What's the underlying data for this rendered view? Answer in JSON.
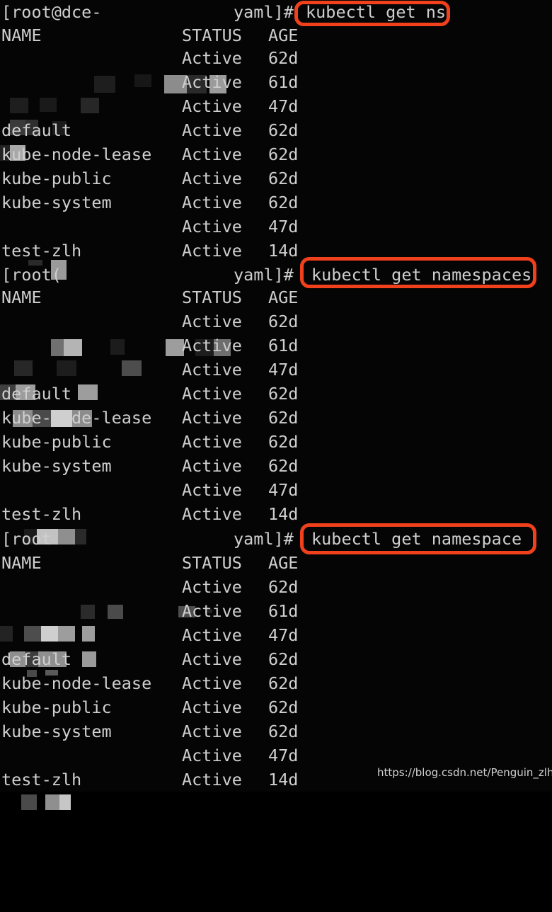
{
  "terminal": {
    "theme": {
      "background": "#050505",
      "foreground": "#cfcfcf",
      "highlight_box": "#f0401c",
      "redaction_grays": [
        "#1c1c1c",
        "#2b2b2b",
        "#3a3a3a",
        "#555555",
        "#6e6e6e",
        "#8a8a8a",
        "#a6a6a6",
        "#c0c0c0",
        "#d4d4d4"
      ]
    },
    "columns": {
      "name": "NAME",
      "status": "STATUS",
      "age": "AGE"
    },
    "blocks": [
      {
        "id": "block-1",
        "prompt": {
          "user_host": "[root@dce-",
          "path_end": "yaml]#",
          "redacted": true
        },
        "command": "kubectl get ns",
        "highlighted": true,
        "header": {
          "name": "NAME",
          "status": "STATUS",
          "age": "AGE"
        },
        "rows": [
          {
            "name": "",
            "redacted": true,
            "status": "Active",
            "age": "62d"
          },
          {
            "name": "",
            "redacted": true,
            "status": "Active",
            "age": "61d"
          },
          {
            "name": "",
            "redacted": true,
            "status": "Active",
            "age": "47d"
          },
          {
            "name": "default",
            "redacted": false,
            "status": "Active",
            "age": "62d"
          },
          {
            "name": "kube-node-lease",
            "redacted": false,
            "status": "Active",
            "age": "62d"
          },
          {
            "name": "kube-public",
            "redacted": false,
            "status": "Active",
            "age": "62d"
          },
          {
            "name": "kube-system",
            "redacted": false,
            "status": "Active",
            "age": "62d"
          },
          {
            "name": "",
            "redacted": true,
            "status": "Active",
            "age": "47d"
          },
          {
            "name": "test-zlh",
            "redacted": false,
            "status": "Active",
            "age": "14d"
          }
        ]
      },
      {
        "id": "block-2",
        "prompt": {
          "user_host": "[root(",
          "path_end": "yaml]#",
          "redacted": true
        },
        "command": "kubectl get namespaces",
        "highlighted": true,
        "header": {
          "name": "NAME",
          "status": "STATUS",
          "age": "AGE"
        },
        "rows": [
          {
            "name": "",
            "redacted": true,
            "status": "Active",
            "age": "62d"
          },
          {
            "name": "",
            "redacted": true,
            "status": "Active",
            "age": "61d"
          },
          {
            "name": "",
            "redacted": true,
            "status": "Active",
            "age": "47d"
          },
          {
            "name": "default",
            "redacted": false,
            "status": "Active",
            "age": "62d"
          },
          {
            "name": "kube-node-lease",
            "redacted": false,
            "status": "Active",
            "age": "62d"
          },
          {
            "name": "kube-public",
            "redacted": false,
            "status": "Active",
            "age": "62d"
          },
          {
            "name": "kube-system",
            "redacted": false,
            "status": "Active",
            "age": "62d"
          },
          {
            "name": "",
            "redacted": true,
            "status": "Active",
            "age": "47d"
          },
          {
            "name": "test-zlh",
            "redacted": false,
            "status": "Active",
            "age": "14d"
          }
        ]
      },
      {
        "id": "block-3",
        "prompt": {
          "user_host": "[root",
          "path_end": "yaml]#",
          "redacted": true
        },
        "command": "kubectl get namespace",
        "highlighted": true,
        "header": {
          "name": "NAME",
          "status": "STATUS",
          "age": "AGE"
        },
        "rows": [
          {
            "name": "",
            "redacted": true,
            "status": "Active",
            "age": "62d"
          },
          {
            "name": "",
            "redacted": true,
            "status": "Active",
            "age": "61d"
          },
          {
            "name": "",
            "redacted": true,
            "status": "Active",
            "age": "47d"
          },
          {
            "name": "default",
            "redacted": false,
            "status": "Active",
            "age": "62d"
          },
          {
            "name": "kube-node-lease",
            "redacted": false,
            "status": "Active",
            "age": "62d"
          },
          {
            "name": "kube-public",
            "redacted": false,
            "status": "Active",
            "age": "62d"
          },
          {
            "name": "kube-system",
            "redacted": false,
            "status": "Active",
            "age": "62d"
          },
          {
            "name": "",
            "redacted": true,
            "status": "Active",
            "age": "47d"
          },
          {
            "name": "test-zlh",
            "redacted": false,
            "status": "Active",
            "age": "14d"
          }
        ]
      }
    ]
  },
  "watermark": {
    "text": "https://blog.csdn.net/Penguin_zlh"
  }
}
